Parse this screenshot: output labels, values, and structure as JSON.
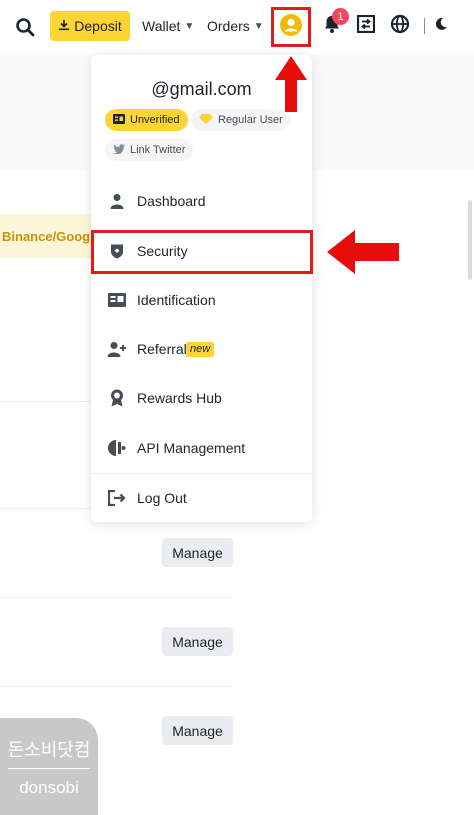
{
  "nav": {
    "deposit_label": "Deposit",
    "wallet_label": "Wallet",
    "orders_label": "Orders",
    "notification_count": "1",
    "icons": [
      "search-icon",
      "download-icon",
      "user-circle-icon",
      "bell-icon",
      "transfer-icon",
      "globe-icon",
      "moon-icon"
    ]
  },
  "dropdown": {
    "email": "@gmail.com",
    "chips": {
      "unverified": "Unverified",
      "regular_user": "Regular User",
      "link_twitter": "Link Twitter"
    },
    "items": [
      {
        "label": "Dashboard",
        "icon": "user-icon"
      },
      {
        "label": "Security",
        "icon": "shield-icon"
      },
      {
        "label": "Identification",
        "icon": "id-card-icon"
      },
      {
        "label": "Referral",
        "icon": "add-user-icon",
        "badge": "new"
      },
      {
        "label": "Rewards Hub",
        "icon": "award-icon"
      },
      {
        "label": "API Management",
        "icon": "api-icon"
      },
      {
        "label": "Log Out",
        "icon": "logout-icon"
      }
    ]
  },
  "background": {
    "binance_google_label": "Binance/Google",
    "manage_buttons": [
      "Manage",
      "Manage",
      "Manage"
    ]
  },
  "watermark": {
    "korean": "돈소비닷컴",
    "latin": "donsobi"
  },
  "colors": {
    "brand_yellow": "#fcd535",
    "annotation_red": "#e21b1b",
    "text_primary": "#1e2329"
  }
}
